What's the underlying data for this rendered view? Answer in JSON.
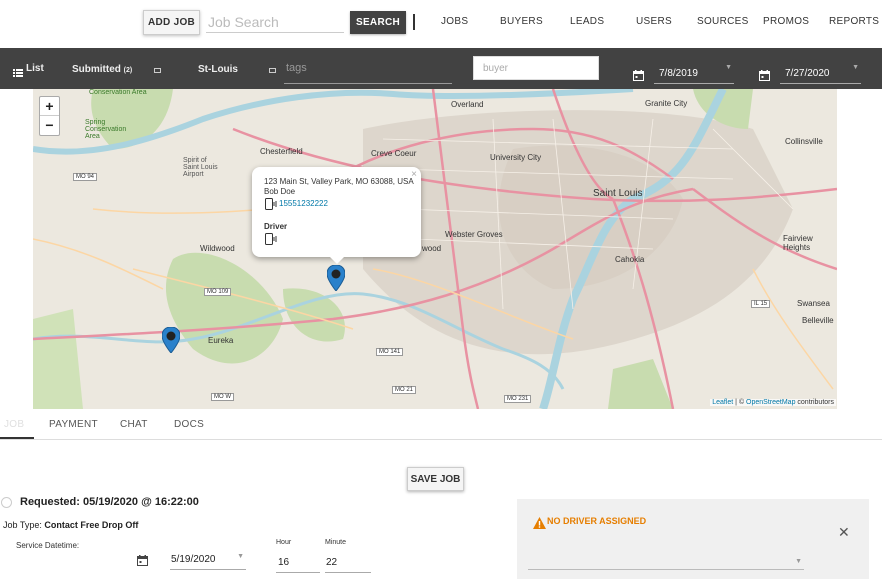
{
  "topnav": {
    "add_job": "ADD JOB",
    "search_placeholder": "Job Search",
    "search_button": "SEARCH",
    "links": [
      "JOBS",
      "BUYERS",
      "LEADS",
      "USERS",
      "SOURCES",
      "PROMOS",
      "REPORTS"
    ]
  },
  "filterbar": {
    "list_label": "List",
    "submitted_label": "Submitted",
    "submitted_count": "(2)",
    "location": "St-Louis",
    "tags_placeholder": "tags",
    "buyer_placeholder": "buyer",
    "date_from": "7/8/2019",
    "date_to": "7/27/2020"
  },
  "map": {
    "zoom_in": "+",
    "zoom_out": "−",
    "attribution_leaflet": "Leaflet",
    "attribution_sep": " | © ",
    "attribution_osm": "OpenStreetMap",
    "attribution_suffix": " contributors",
    "labels": {
      "overland": "Overland",
      "granite_city": "Granite City",
      "chesterfield": "Chesterfield",
      "creve_coeur": "Creve Coeur",
      "university_city": "University City",
      "saint_louis": "Saint Louis",
      "collinsville": "Collinsville",
      "wildwood": "Wildwood",
      "webster_groves": "Webster Groves",
      "cahokia": "Cahokia",
      "fairview_heights": "Fairview Heights",
      "swansea": "Swansea",
      "belleville": "Belleville",
      "eureka": "Eureka",
      "wood": "wood",
      "conservation_area": "Conservation Area",
      "busch": "Spring Conservation Area",
      "spirit": "Spirit of Saint Louis Airport"
    },
    "shields": [
      "MO 94",
      "MO 109",
      "MO 141",
      "MO 21",
      "MO 231",
      "MO W",
      "IL 15"
    ],
    "popup": {
      "address": "123 Main St, Valley Park, MO 63088, USA",
      "name": "Bob Doe",
      "phone": "15551232222",
      "driver_label": "Driver",
      "close": "×"
    }
  },
  "tabs": [
    "JOB",
    "PAYMENT",
    "CHAT",
    "DOCS"
  ],
  "job": {
    "save_button": "SAVE JOB",
    "requested": "Requested: 05/19/2020 @ 16:22:00",
    "job_type_label": "Job Type: ",
    "job_type_value": "Contact Free Drop Off",
    "service_datetime_label": "Service Datetime:",
    "service_date": "5/19/2020",
    "hour_label": "Hour",
    "hour_value": "16",
    "minute_label": "Minute",
    "minute_value": "22"
  },
  "driver_panel": {
    "warning": "NO DRIVER ASSIGNED",
    "close": "✕"
  },
  "colors": {
    "dark_bar": "#424242",
    "warning": "#e67e00",
    "pin": "#2a81cb",
    "link": "#0078a8"
  }
}
